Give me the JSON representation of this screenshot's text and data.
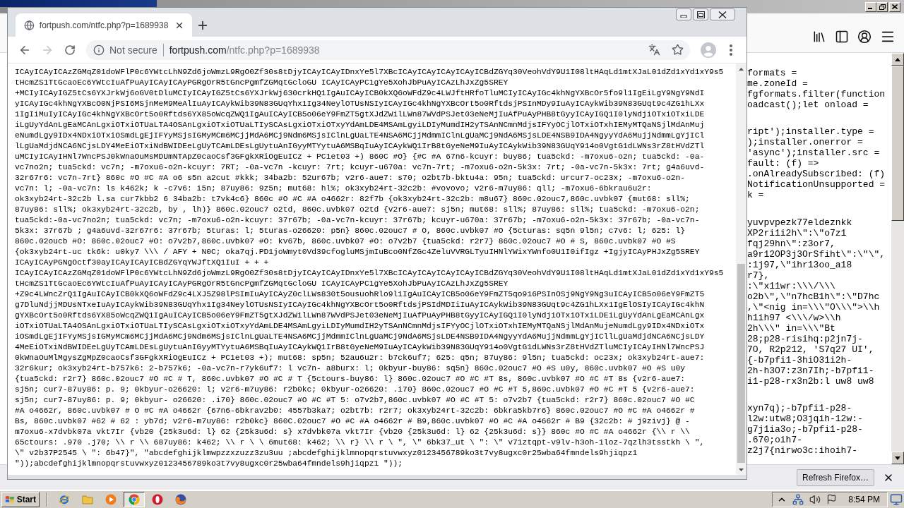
{
  "background_window": {
    "source_blocks": [
      {
        "lines": [
          "formats =",
          "me.zoneId =",
          "fgformats.filter(function",
          "oadcast();let onload ="
        ]
      },
      {
        "lines": [
          "ript');installer.type =",
          ");installer.onerror =",
          "'async');installer.src =",
          "fault: (f) =>",
          ".onAlreadySubscribed: (f)",
          "NotificationUnsupported =",
          "k ="
        ]
      },
      {
        "lines": [
          "yuvpvpezk77eldeznkk",
          "XP2ri1i2h\\\":\\\"o7z1",
          "fqj29hn\\\":z3or7,",
          "a9r12OP3j3OrSfiht\\\":\\\"\\\",",
          ":1j97,\\\"ihr13oo_a18",
          "r7},",
          ":\\\"x11wr:\\\\\\/\\\\\\",
          "o2b\\\",\\\"n7hcB1h\\\":\\\"D7hc",
          ",\\\"<nig in=\\\\\\\"O\\\\\\\">\\\\h",
          "h1ih97 <\\\\\\/w>\\\\h",
          "2h\\\\\\\" in=\\\\\\\"Bt",
          "28;p28-risihq:p2jn7j-",
          "7O, R2p212, 'S7q27 UI',",
          "{-b7pfi1-3hiO31i2h-",
          "2h-h3O7:z3n7Ih;-b7pfi1-",
          "i1-p28-rx3n2b:l uw8 uw8"
        ]
      },
      {
        "lines": [
          "xyn7q);-b7pfi1-p28-",
          "l2w:utw8;O3jqih-12w:-",
          "g7j1ia3o;-b7pfi1-p28-",
          ".670;oih7-",
          "z2j7{nirwo3c:ihoih7-"
        ]
      }
    ],
    "notification": {
      "button": "Refresh Firefox…"
    }
  },
  "browser": {
    "tabs": [
      {
        "title": "fortpush.com/ntfc.php?p=1689938",
        "selected": true
      }
    ],
    "address_bar": {
      "security": "Not secure",
      "host": "fortpush.com",
      "path": "/ntfc.php?p=1689938"
    },
    "page_lines": [
      "ICAyICAyICAzZGMqZ01doWFlP0c6YWtcLhN9Zd6joWmzL9RgO0Zf30s8tDjyICAyICAyIDnxYe5l7XBcICAyICAyICAyICAyICBdZGYq30VeohVdY9U1I08ltHAqLd1mtXJaL01dZd1xYd1xY9s5",
      "tHcmZS1TtGcaoEc6YWtcIuAfPuAyICAyICAyPGRgOrR5tGncPgmfZGMqtGcloGU ICAyICAyPC1gYe5XohJbPuAyICAzLhJxZg5SREY",
      "+MCIyICAyIGZ5tCs6YXJrkWj6oGV0tDluMCIyICAyIGZ5tCs6YXJrkWj630crkHQ1IgAuICAyICB0kXQ6oWFdZ9c4LWJftHRfoTluMCIyICAyIGc4khNgYXBcOr5fo9l1IgEiLgY9NgY9NdI",
      "yICAyIGc4khNgYXBcO0NjPSI6MSjnMeM9MeAlIuAyICAykWib39N83GUqYhx1Ig34NeylOTUsNSIyICAyIGc4khNgYXBcOrt5o0RftdsjPSInMDy9IuAyICAykWib39N83GUqt9c4ZG1hLXx",
      "1IgIiMuIyICAyIGc4khNgYXBcOrt5o0Rftds6YX85oWcqZWQ1IgAuICAyICB5o06eY9FmZT5gtXJdZWilLWn87WVdPSJet03eNeMjIuAfPuAyPHB8tGyyICAyIGQ1I0lyNdjiOTxiOTxiLDE",
      "iLgUyYdAnLgEaMCAnLgxiOTxiOTUaLTA4OSAnLgxiOTxiOTUaLTIySCAsLgxiOTxiOTxyYdAmLDE4MSAmLgyiLDIyMumdIH2yTSAnNCmnMdjsIFYyOCjlOTxiOTxhIEMyMTQaNSjlMdAnMuj",
      "eNumdLgy9IDx4NDxiOTxiOSmdLgEjIFYyMSjsIGMyMCm6MCjjMdA6MCj9Ndm6MSjsIClnLgUaLTE4NSA6MCjjMdmmIClnLgUaMCj9NdA6MSjsLDE4NSB9IDA4NgyyYdA6MujjNdmmLgYjICl",
      "lLgUaMdjdNCA6NCjsLDY4MeEiOTxiNdBWIDEeLgUyTCAmLDEsLgUytuAnIGyyMTYytuA6MSBqIuAyICAykWQ1IrB8tGyeNeM9IuAyICAykWib39N83GUqY914o0VgtG1dLWNs3rZ8tHVdZTl",
      "uMCIyICAyIHNl7WncPSJ0kWnaOuMsMDUmNTApZ0caoCsf3GFgkXRiOgEuICz + PC1et03 +) 860C #O} {#C #A 67n6-kcuyr: buy86; tua5ckd: -m7oxu6-o2n; tua5ckd: -0a-",
      "vc7no2n; tua5ckd: vc7n; -m7oxu6-o2n-kcuyr: 7RT; -0a-vc7n -kcuyr: 7rt; kcuyr-u670a: vc7n-7rt; -m7oxu6-o2n-5k3x: 7rt; -0a-vc7n-5k3x: 7rt; g4a6uvd-",
      "32r67r6: vc7n-7rt} 860c #O #C #A o6 s5n a2cut #kkk; 34ba2b: 52ur67b; v2r6-aue7: s70; o2bt7b-bktu4a: 95n; tua5ckd: urcur7-oc23x; -m7oxu6-o2n-",
      "vc7n: l; -0a-vc7n: ls k462k; k -c7v6: i5n; 87uy86: 9z5n; mut68: hl%; ok3xyb24rt-32c2b: #vovovo; v2r6-m7uy86: qll; -m7oxu6-6bkrau6u2r:",
      "ok3xyb24rt-32c2b l.sa cur7kbb2 6 34ba2b: t7vk4c6} 860c #O #C #A o4662r: 82f7b {ok3xyb24rt-32c2b: m8u67} 860c.02ouc7,860c.uvbk07 {mut68: sll%;",
      "87uy86: sll%; ok3xyb24rt-32c2b, by , lh)} 860c.02ouc7 o2td, 860c.uvbk07 o2td {v2r6-aue7: sj5n; mut68: sll%; 87uy86: sll%; tua5ckd: -m7oxu6-o2n;",
      "tua5ckd:-0a-vc7no2n; tua5ckd: vc7n; -m7oxu6-o2n-kcuyr: 37r67b; -0a-vc7n-kcuyr: 37r67b; kcuyr-u670a: 37r67b; -m7oxu6-o2n-5k3x: 37r67b; -0a-vc7n-",
      "5k3x: 37r67b ; g4a6uvd-32r67r6: 37r67b; 5turas: l; 5turas-o26620: p5n} 860c.02ouc7 # O, 860c.uvbk07 #O {5cturas: sq5n 9l5n; c7v6: l; 625: l}",
      "860c.02oucb #O: 860c.02ouc7 #O: o7v2b7,860c.uvbk07 #O: kv67b, 860c.uvbk07 #O: o7v2b7 {tua5ckd: r2r7} 860c.02ouc7 #O # S, 860c.uvbk07 #O #S",
      "{ok3xyb24rt-uc tk6k: u0ky7 \\\\\\ / AFY + N0C; oka7qj.PD1joWmyt0Vd39cfogluMSjmIuBco0NfZGc4ZeluVVRGLTyuIHNlYWixYWnfo0U1I0ifIgz +IgjyICAyPHJxZg5SREY",
      "ICAyICAyPGNgOctf30ayICAyICAyICBdZGYqYWJftXQ1IuI + + +",
      "ICAyICAyICAzZGMqZ01doWFlP0c6YWtcLhN9Zd6joWmzL9RgO0Zf30s8tDjyICAyICAyIDnxYe5l7XBcICAyICAyICAyICAyICBdZGYq30VeohVdY9U1I08ltHAqLd1mtXJaL01dZd1xYd1xY9s5",
      "tHcmZS1TtGcaoEc6YWtcIuAfPuAyICAyICAyPGRgOrR5tGncPgmfZGMqtGcloGU ICAyICAyPC1gYe5XohJbPuAyICAzLhJxZg5SREY",
      "+Z9c4LWncZrQ1IgAuICAyICB0kXQ6oWFdZ9c4LXJ5Z98lPSImIuAyICAyZ0clLWs830t5ousuohRlo9l1IgAuICAyICB5o06eY9FmZT5qo916PSInOSj9NgY9Ng3uICAyICB5o06eY9FmZT5",
      "g7DluNdjjMDUsNTxeIuAyICAykWib39N83GUqYhx1Ig34NeylOTUsNSIyICAyIGc4khNgYXBcOrt5o0RftdsjPSIdMDIiIuAyICAykWib39N83GUqt9c4ZG1hLXx1IgElOSIyICAyIGc4khN",
      "gYXBcOrt5o0Rftds6YX85oWcqZWQ1IgAuICAyICB5o06eY9FmZT5gtXJdZWilLWn87WVdPSJet03eNeMjIuAfPuAyPHB8tGyyICAyIGQ1I0lyNdjiOTxiOTxiLDEiLgUyYdAnLgEaMCAnLgx",
      "iOTxiOTUaLTA4OSAnLgxiOTxiOTUaLTIySCAsLgxiOTxiOTxyYdAmLDE4MSAmLgyiLDIyMumdIH2yTSAnNCmnMdjsIFYyOCjlOTxiOTxhIEMyMTQaNSjlMdAnMujeNumdLgy9IDx4NDxiOTx",
      "iOSmdLgEjIFYyMSjsIGMyMCm6MCjjMdA6MCj9Ndm6MSjsIClnLgUaLTE4NSA6MCjjMdmmIClnLgUaMCj9NdA6MSjsLDE4NSB9IDA4NgyyYdA6MujjNdmmLgYjICllLgUaMdjdNCA6NCjsLDY",
      "4MeEiOTxiNdBWIDEeLgUyTCAmLDEsLgUytuAnIGyyMTYytuA6MSBqIuAyICAykWQ1IrB8tGyeNeM9IuAyICAykWib39N83GUqY914o0VgtG1dLWNs3rZ8tHVdZTluMCIyICAyIHNl7WncPSJ",
      "0kWnaOuMlMgysZgMpZ0caoCsf3GFgkXRiOgEuICz + PC1et03 +); mut68: sp5n; 52au6u2r: b7ck6uf7; 625: q5n; 87uy86: 9l5n; tua5ckd: oc23x; ok3xyb24rt-aue7:",
      "32r6kur; ok3xyb24rt-b757k6: 2-b757k6; -0a-vc7n-r7yk6uf7: l vc7n- a8burx: l; 0kbyur-buy86: sq5n} 860c.02ouc7 #O #S u0y, 860c.uvbk07 #O #S u0y",
      "{tua5ckd: r2r7} 860c.02ouc7 #O #C # T, 860c.uvbk07 #O #C # T {5ctours-buy86: l} 860c.02ouc7 #O #C #T 8s, 860c.uvbk07 #O #C #T 8s {v2r6-aue7:",
      "sj5n; cur7-87uy86: p. 9; 0kbyur-o26620: l; v2r6-m7uy86: r2b0kc; 0kbyur-o26620: .i70} 860c.02ouc7 #O #C #T 5,860c.uvbk07 #O #C #T 5 {v2r6-aue7:",
      "sj5n; cur7-87uy86: p. 9; 0kbyur- o26620: .i70} 860c.02ouc7 #O #C #T 5: o7v2b7,860c.uvbk07 #O #C #T 5: o7v2b7 {tua5ckd: r2r7} 860c.02ouc7 #O #C",
      "#A o4662r, 860c.uvbk07 # O #C #A o4662r {67n6-6bkrav2b0: 4557b3ka7; o2bt7b: r2r7; ok3xyb24rt-32c2b: 6bkra5kb7r6} 860c.02ouc7 #O #C #A o4662r #",
      "Bs, 860c.uvbk07 #62 # 62 : yb7d; v2r6-m7uy86: r2b0kc} 860C.02ouc7 #O #C #A o4662r # B9,860c.uvbk07 #O #C #A o4662r # B9 {32c2b: # j9zivj} @ -",
      "m7oxu6-x7dvbk07a vkt7Ir {vb20 {25k3u6d: l} 62 {25k3u6d: s} x7dvbk07a vkt7Ir {vb20 {25k3u6d: l} 62 {25k3u6d: s}} 860c #O #C #A o4662r {\\\\ r \\\\",
      "65ctours: .970 .j70; \\\\ r \\\\ 687uy86: k462; \\\\ r \\ \\ 6mut68: k462; \\\\ r} \\\\ r \\ \", \\\" 6bk37_ut \\ \": \\\" v71ztqpt-v9lv-h3oh-1loz-7qzlh3tsstkh \\ \",",
      "\\\" v2b37P2545 \\ \": 6b47}\", \"abcdefghijklmwpzzxzuzz3zu3uu ;abcdefghijklmnopqrstuvwxyz0123456789ko3t7vy8ugxc0r25wba64fmndels9hjiqpz1",
      "\"));abcdefghijklmnopqrstuvwxyz0123456789ko3t7vy8ugxc0r25wba64fmndels9hjiqpz1 \"));"
    ]
  },
  "taskbar": {
    "start": "Start",
    "apps": [
      {
        "kind": "orbit",
        "selected": false
      },
      {
        "kind": "folder",
        "selected": false
      },
      {
        "kind": "play",
        "selected": false
      },
      {
        "kind": "wheel",
        "selected": true
      },
      {
        "kind": "ring",
        "selected": false
      },
      {
        "kind": "swirl",
        "selected": false
      }
    ],
    "clock": "8:54 PM"
  }
}
